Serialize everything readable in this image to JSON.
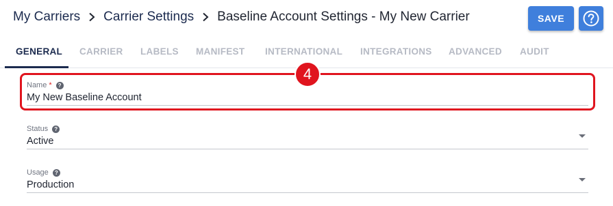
{
  "breadcrumb": {
    "items": [
      {
        "label": "My Carriers"
      },
      {
        "label": "Carrier Settings"
      },
      {
        "label": "Baseline Account Settings - My New Carrier"
      }
    ]
  },
  "toolbar": {
    "save_label": "SAVE",
    "help_icon": "help-circle-icon"
  },
  "tabs": [
    {
      "label": "GENERAL",
      "active": true
    },
    {
      "label": "CARRIER",
      "active": false
    },
    {
      "label": "LABELS",
      "active": false
    },
    {
      "label": "MANIFEST",
      "active": false
    },
    {
      "label": "INTERNATIONAL",
      "active": false
    },
    {
      "label": "INTEGRATIONS",
      "active": false
    },
    {
      "label": "ADVANCED",
      "active": false
    },
    {
      "label": "AUDIT",
      "active": false
    }
  ],
  "form": {
    "name": {
      "label": "Name",
      "required_mark": "*",
      "value": "My New Baseline Account"
    },
    "status": {
      "label": "Status",
      "value": "Active"
    },
    "usage": {
      "label": "Usage",
      "value": "Production"
    }
  },
  "annotation": {
    "step_number": "4"
  },
  "colors": {
    "accent": "#3f7fdc",
    "nav_text": "#1b2a4e",
    "inactive_tab": "#b6bac4",
    "highlight": "#e0141e"
  }
}
